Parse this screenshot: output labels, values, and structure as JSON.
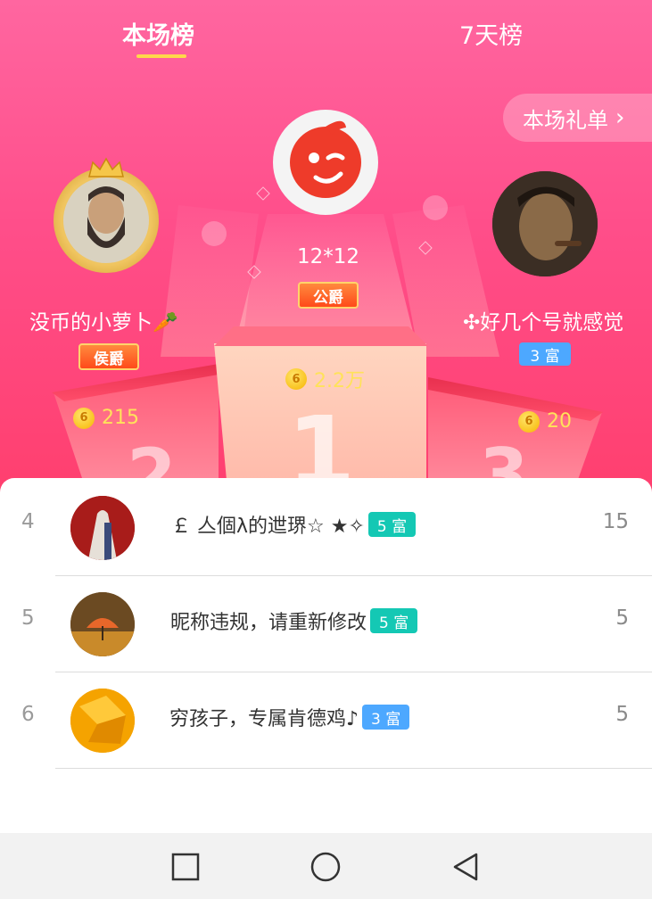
{
  "tabs": [
    {
      "label": "本场榜",
      "active": true
    },
    {
      "label": "7天榜",
      "active": false
    }
  ],
  "gift_list_button": {
    "label": "本场礼单",
    "icon": "chevron-right-icon"
  },
  "podium": {
    "first": {
      "name": "12*12",
      "title": "公爵",
      "score": "2.2万",
      "place": "1"
    },
    "second": {
      "name": "没币的小萝卜🥕",
      "title": "侯爵",
      "score": "215",
      "place": "2"
    },
    "third": {
      "name": "✣好几个号就感觉",
      "rich_level": "3 富",
      "score": "20",
      "place": "3"
    }
  },
  "coin_glyph": "6",
  "ranking": [
    {
      "rank": "4",
      "name": "￡ 亼個λ的迣琾☆ ★✧",
      "badge": "5 富",
      "value": "15",
      "badge_color": "#14c8b4"
    },
    {
      "rank": "5",
      "name": "昵称违规，请重新修改",
      "badge": "5 富",
      "value": "5",
      "badge_color": "#14c8b4"
    },
    {
      "rank": "6",
      "name": "穷孩子，专属肯德鸡♪",
      "badge": "3 富",
      "value": "5",
      "badge_color": "#4da8ff"
    }
  ],
  "nav": [
    {
      "icon": "recents-square-icon"
    },
    {
      "icon": "home-circle-icon"
    },
    {
      "icon": "back-triangle-icon"
    }
  ],
  "colors": {
    "accent": "#ff4e8a",
    "coin": "#f7b400",
    "teal_badge": "#14c8b4",
    "blue_badge": "#4da8ff"
  }
}
